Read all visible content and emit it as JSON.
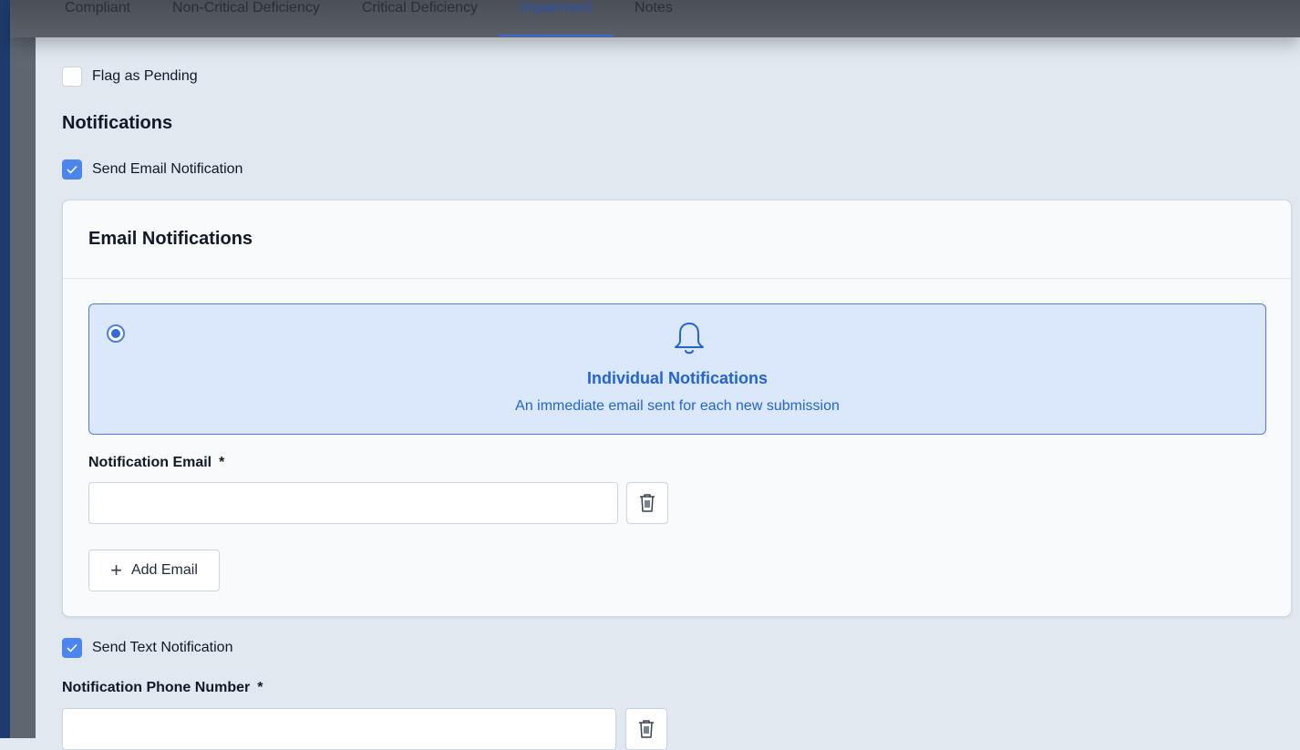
{
  "tabs": [
    {
      "label": "Compliant"
    },
    {
      "label": "Non-Critical Deficiency"
    },
    {
      "label": "Critical Deficiency"
    },
    {
      "label": "Impairment"
    },
    {
      "label": "Notes"
    }
  ],
  "active_tab": "Impairment",
  "flag_pending": {
    "label": "Flag as Pending",
    "checked": false
  },
  "notifications_title": "Notifications",
  "send_email": {
    "label": "Send Email Notification",
    "checked": true
  },
  "email_card": {
    "title": "Email Notifications",
    "option": {
      "title": "Individual Notifications",
      "description": "An immediate email sent for each new submission",
      "selected": true,
      "icon": "bell-icon"
    },
    "email_field": {
      "label": "Notification Email",
      "required_mark": "*",
      "value": "",
      "placeholder": ""
    },
    "add_email_label": "Add Email"
  },
  "send_text": {
    "label": "Send Text Notification",
    "checked": true
  },
  "phone_field": {
    "label": "Notification Phone Number",
    "required_mark": "*",
    "value": "",
    "placeholder": ""
  },
  "colors": {
    "accent": "#2363d6",
    "checkbox": "#4a86ec",
    "option_bg": "#dbe8fb"
  }
}
